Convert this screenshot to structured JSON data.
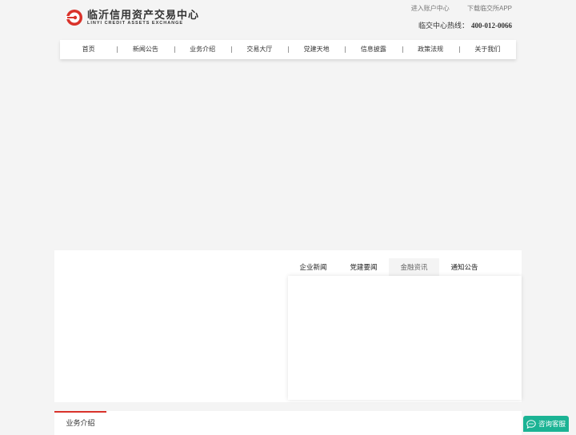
{
  "header": {
    "logo_cn": "临沂信用资产交易中心",
    "logo_en": "LINYI CREDIT ASSETS EXCHANGE",
    "top_links": {
      "account": "进入账户中心",
      "app": "下载临交所APP"
    },
    "hotline_label": "临交中心热线：",
    "hotline_number": "400-012-0066"
  },
  "nav": {
    "items": [
      "首页",
      "新闻公告",
      "业务介绍",
      "交易大厅",
      "党建天地",
      "信息披露",
      "政策法规",
      "关于我们"
    ]
  },
  "news": {
    "tabs": [
      "企业新闻",
      "党建要闻",
      "金融资讯",
      "通知公告"
    ],
    "active_tab": 2
  },
  "business": {
    "title": "业务介绍"
  },
  "service": {
    "label": "咨询客服"
  },
  "colors": {
    "brand_red": "#d9322a",
    "service_green": "#1bb394"
  }
}
